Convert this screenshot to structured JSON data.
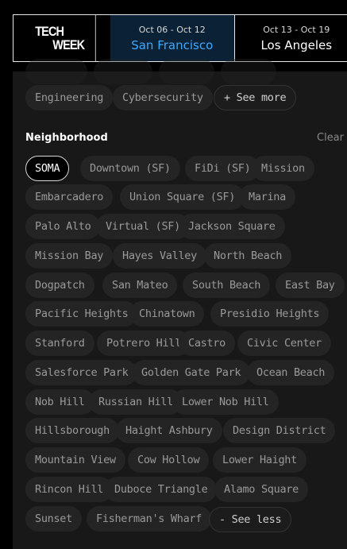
{
  "header": {
    "logo_line1": "TECH",
    "logo_line2": "WEEK",
    "weeks": [
      {
        "dates": "Oct 06 - Oct 12",
        "city": "San Francisco",
        "active": true
      },
      {
        "dates": "Oct 13 - Oct 19",
        "city": "Los Angeles",
        "active": false
      }
    ]
  },
  "topics": {
    "chips": [
      "Engineering",
      "Cybersecurity"
    ],
    "see_more": "+ See more"
  },
  "neighborhood": {
    "title": "Neighborhood",
    "clear_label": "Clear",
    "selected": "SOMA",
    "chips": [
      "SOMA",
      "Downtown (SF)",
      "FiDi (SF)",
      "Mission",
      "Embarcadero",
      "Union Square (SF)",
      "Marina",
      "Palo Alto",
      "Virtual (SF)",
      "Jackson Square",
      "Mission Bay",
      "Hayes Valley",
      "North Beach",
      "Dogpatch",
      "San Mateo",
      "South Beach",
      "East Bay",
      "Pacific Heights",
      "Chinatown",
      "Presidio Heights",
      "Stanford",
      "Potrero Hill",
      "Castro",
      "Civic Center",
      "Salesforce Park",
      "Golden Gate Park",
      "Ocean Beach",
      "Nob Hill",
      "Russian Hill",
      "Lower Nob Hill",
      "Hillsborough",
      "Haight Ashbury",
      "Design District",
      "Mountain View",
      "Cow Hollow",
      "Lower Haight",
      "Rincon Hill",
      "Duboce Triangle",
      "Alamo Square",
      "Sunset",
      "Fisherman's Wharf"
    ],
    "see_less": "- See less"
  }
}
